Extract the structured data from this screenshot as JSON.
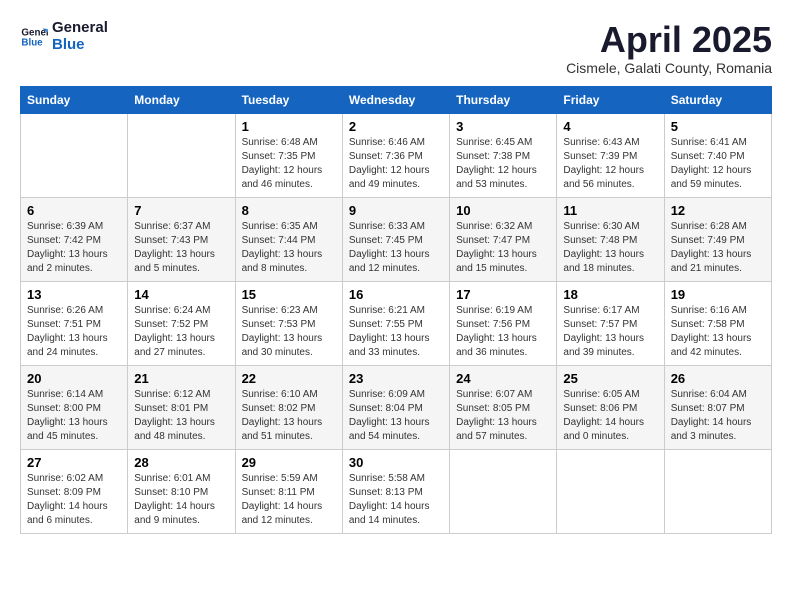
{
  "logo": {
    "line1": "General",
    "line2": "Blue"
  },
  "title": "April 2025",
  "subtitle": "Cismele, Galati County, Romania",
  "days_header": [
    "Sunday",
    "Monday",
    "Tuesday",
    "Wednesday",
    "Thursday",
    "Friday",
    "Saturday"
  ],
  "weeks": [
    [
      {
        "day": "",
        "info": ""
      },
      {
        "day": "",
        "info": ""
      },
      {
        "day": "1",
        "info": "Sunrise: 6:48 AM\nSunset: 7:35 PM\nDaylight: 12 hours and 46 minutes."
      },
      {
        "day": "2",
        "info": "Sunrise: 6:46 AM\nSunset: 7:36 PM\nDaylight: 12 hours and 49 minutes."
      },
      {
        "day": "3",
        "info": "Sunrise: 6:45 AM\nSunset: 7:38 PM\nDaylight: 12 hours and 53 minutes."
      },
      {
        "day": "4",
        "info": "Sunrise: 6:43 AM\nSunset: 7:39 PM\nDaylight: 12 hours and 56 minutes."
      },
      {
        "day": "5",
        "info": "Sunrise: 6:41 AM\nSunset: 7:40 PM\nDaylight: 12 hours and 59 minutes."
      }
    ],
    [
      {
        "day": "6",
        "info": "Sunrise: 6:39 AM\nSunset: 7:42 PM\nDaylight: 13 hours and 2 minutes."
      },
      {
        "day": "7",
        "info": "Sunrise: 6:37 AM\nSunset: 7:43 PM\nDaylight: 13 hours and 5 minutes."
      },
      {
        "day": "8",
        "info": "Sunrise: 6:35 AM\nSunset: 7:44 PM\nDaylight: 13 hours and 8 minutes."
      },
      {
        "day": "9",
        "info": "Sunrise: 6:33 AM\nSunset: 7:45 PM\nDaylight: 13 hours and 12 minutes."
      },
      {
        "day": "10",
        "info": "Sunrise: 6:32 AM\nSunset: 7:47 PM\nDaylight: 13 hours and 15 minutes."
      },
      {
        "day": "11",
        "info": "Sunrise: 6:30 AM\nSunset: 7:48 PM\nDaylight: 13 hours and 18 minutes."
      },
      {
        "day": "12",
        "info": "Sunrise: 6:28 AM\nSunset: 7:49 PM\nDaylight: 13 hours and 21 minutes."
      }
    ],
    [
      {
        "day": "13",
        "info": "Sunrise: 6:26 AM\nSunset: 7:51 PM\nDaylight: 13 hours and 24 minutes."
      },
      {
        "day": "14",
        "info": "Sunrise: 6:24 AM\nSunset: 7:52 PM\nDaylight: 13 hours and 27 minutes."
      },
      {
        "day": "15",
        "info": "Sunrise: 6:23 AM\nSunset: 7:53 PM\nDaylight: 13 hours and 30 minutes."
      },
      {
        "day": "16",
        "info": "Sunrise: 6:21 AM\nSunset: 7:55 PM\nDaylight: 13 hours and 33 minutes."
      },
      {
        "day": "17",
        "info": "Sunrise: 6:19 AM\nSunset: 7:56 PM\nDaylight: 13 hours and 36 minutes."
      },
      {
        "day": "18",
        "info": "Sunrise: 6:17 AM\nSunset: 7:57 PM\nDaylight: 13 hours and 39 minutes."
      },
      {
        "day": "19",
        "info": "Sunrise: 6:16 AM\nSunset: 7:58 PM\nDaylight: 13 hours and 42 minutes."
      }
    ],
    [
      {
        "day": "20",
        "info": "Sunrise: 6:14 AM\nSunset: 8:00 PM\nDaylight: 13 hours and 45 minutes."
      },
      {
        "day": "21",
        "info": "Sunrise: 6:12 AM\nSunset: 8:01 PM\nDaylight: 13 hours and 48 minutes."
      },
      {
        "day": "22",
        "info": "Sunrise: 6:10 AM\nSunset: 8:02 PM\nDaylight: 13 hours and 51 minutes."
      },
      {
        "day": "23",
        "info": "Sunrise: 6:09 AM\nSunset: 8:04 PM\nDaylight: 13 hours and 54 minutes."
      },
      {
        "day": "24",
        "info": "Sunrise: 6:07 AM\nSunset: 8:05 PM\nDaylight: 13 hours and 57 minutes."
      },
      {
        "day": "25",
        "info": "Sunrise: 6:05 AM\nSunset: 8:06 PM\nDaylight: 14 hours and 0 minutes."
      },
      {
        "day": "26",
        "info": "Sunrise: 6:04 AM\nSunset: 8:07 PM\nDaylight: 14 hours and 3 minutes."
      }
    ],
    [
      {
        "day": "27",
        "info": "Sunrise: 6:02 AM\nSunset: 8:09 PM\nDaylight: 14 hours and 6 minutes."
      },
      {
        "day": "28",
        "info": "Sunrise: 6:01 AM\nSunset: 8:10 PM\nDaylight: 14 hours and 9 minutes."
      },
      {
        "day": "29",
        "info": "Sunrise: 5:59 AM\nSunset: 8:11 PM\nDaylight: 14 hours and 12 minutes."
      },
      {
        "day": "30",
        "info": "Sunrise: 5:58 AM\nSunset: 8:13 PM\nDaylight: 14 hours and 14 minutes."
      },
      {
        "day": "",
        "info": ""
      },
      {
        "day": "",
        "info": ""
      },
      {
        "day": "",
        "info": ""
      }
    ]
  ]
}
